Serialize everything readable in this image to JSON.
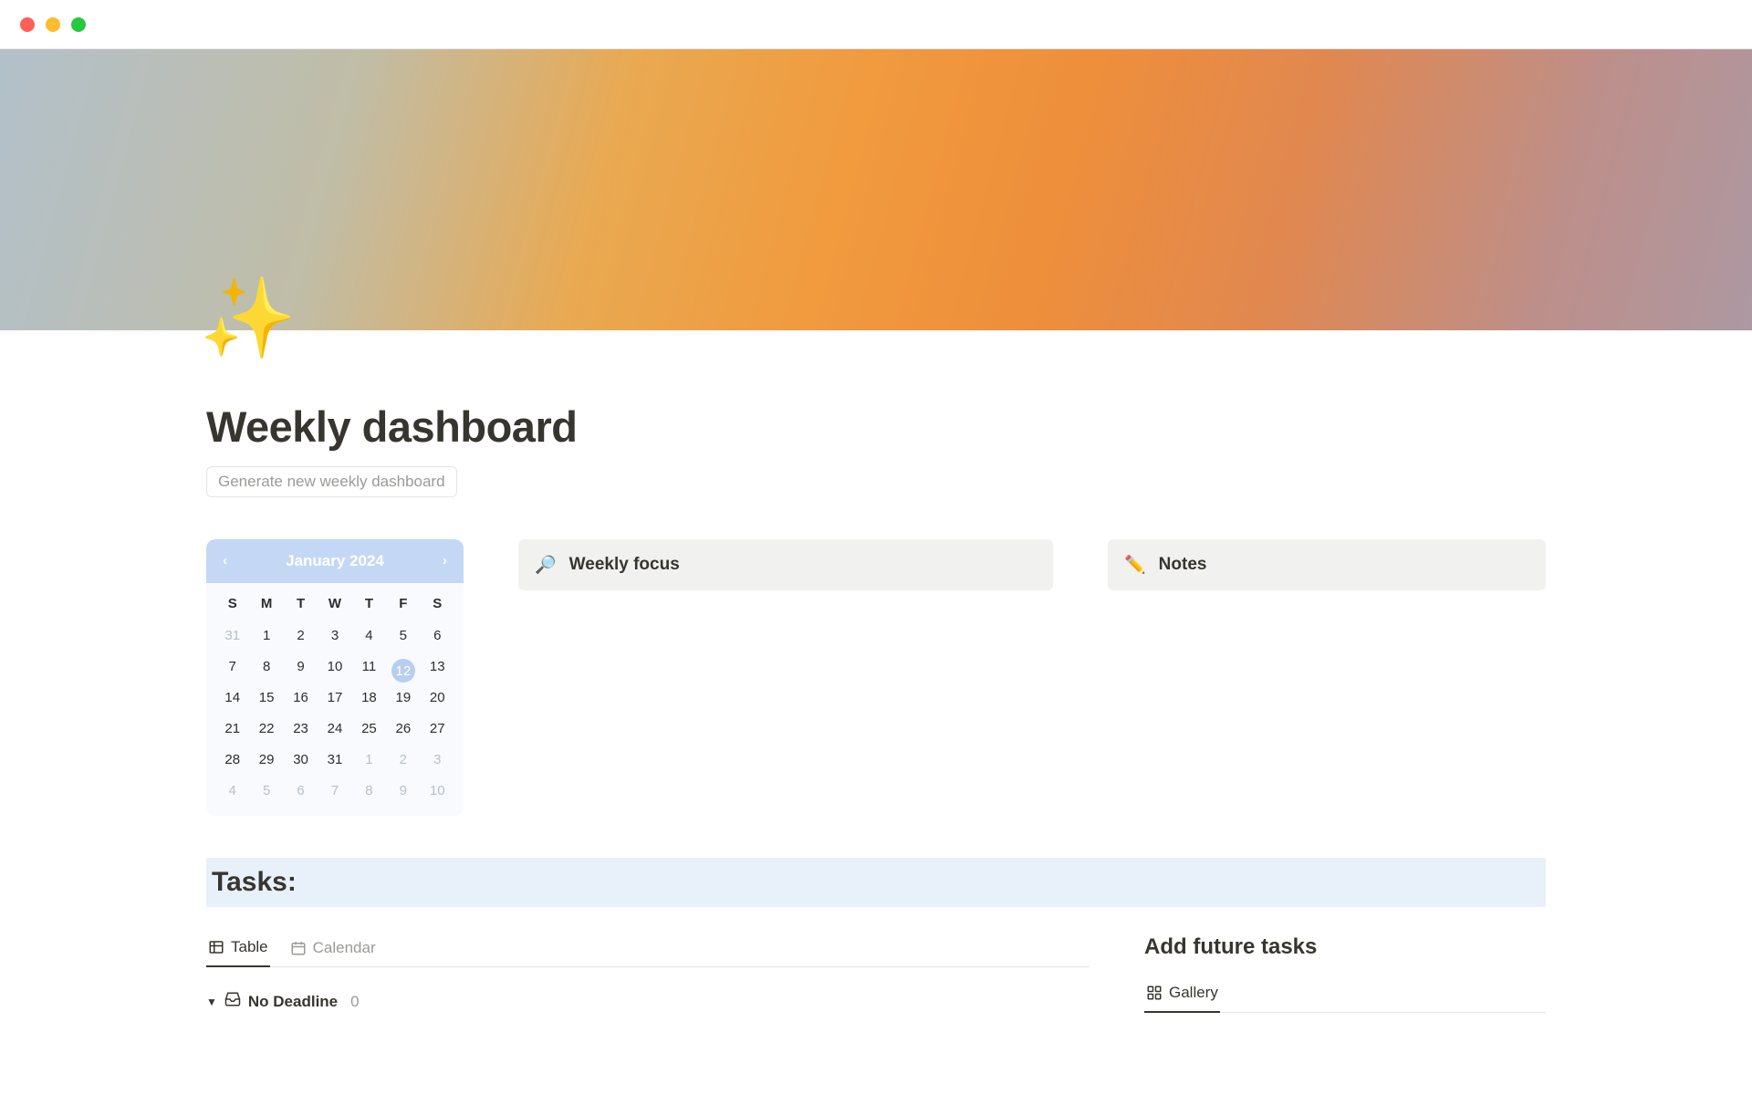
{
  "page": {
    "icon": "✨",
    "title": "Weekly dashboard",
    "generate_button": "Generate new weekly dashboard"
  },
  "calendar": {
    "month_label": "January 2024",
    "dow": [
      "S",
      "M",
      "T",
      "W",
      "T",
      "F",
      "S"
    ],
    "weeks": [
      [
        {
          "d": "31",
          "muted": true
        },
        {
          "d": "1"
        },
        {
          "d": "2"
        },
        {
          "d": "3"
        },
        {
          "d": "4"
        },
        {
          "d": "5"
        },
        {
          "d": "6"
        }
      ],
      [
        {
          "d": "7"
        },
        {
          "d": "8"
        },
        {
          "d": "9"
        },
        {
          "d": "10"
        },
        {
          "d": "11"
        },
        {
          "d": "12",
          "selected": true
        },
        {
          "d": "13"
        }
      ],
      [
        {
          "d": "14"
        },
        {
          "d": "15"
        },
        {
          "d": "16"
        },
        {
          "d": "17"
        },
        {
          "d": "18"
        },
        {
          "d": "19"
        },
        {
          "d": "20"
        }
      ],
      [
        {
          "d": "21"
        },
        {
          "d": "22"
        },
        {
          "d": "23"
        },
        {
          "d": "24"
        },
        {
          "d": "25"
        },
        {
          "d": "26"
        },
        {
          "d": "27"
        }
      ],
      [
        {
          "d": "28"
        },
        {
          "d": "29"
        },
        {
          "d": "30"
        },
        {
          "d": "31"
        },
        {
          "d": "1",
          "muted": true
        },
        {
          "d": "2",
          "muted": true
        },
        {
          "d": "3",
          "muted": true
        }
      ],
      [
        {
          "d": "4",
          "muted": true
        },
        {
          "d": "5",
          "muted": true
        },
        {
          "d": "6",
          "muted": true
        },
        {
          "d": "7",
          "muted": true
        },
        {
          "d": "8",
          "muted": true
        },
        {
          "d": "9",
          "muted": true
        },
        {
          "d": "10",
          "muted": true
        }
      ]
    ]
  },
  "cards": {
    "weekly_focus": {
      "icon": "🔎",
      "label": "Weekly focus"
    },
    "notes": {
      "icon": "✏️",
      "label": "Notes"
    }
  },
  "tasks": {
    "heading": "Tasks:",
    "tabs": [
      {
        "key": "table",
        "label": "Table",
        "icon": "table-icon",
        "active": true
      },
      {
        "key": "calendar",
        "label": "Calendar",
        "icon": "calendar-icon",
        "active": false
      }
    ],
    "group": {
      "label": "No Deadline",
      "count": "0"
    }
  },
  "future": {
    "heading": "Add future tasks",
    "tabs": [
      {
        "key": "gallery",
        "label": "Gallery",
        "icon": "gallery-icon",
        "active": true
      }
    ]
  }
}
